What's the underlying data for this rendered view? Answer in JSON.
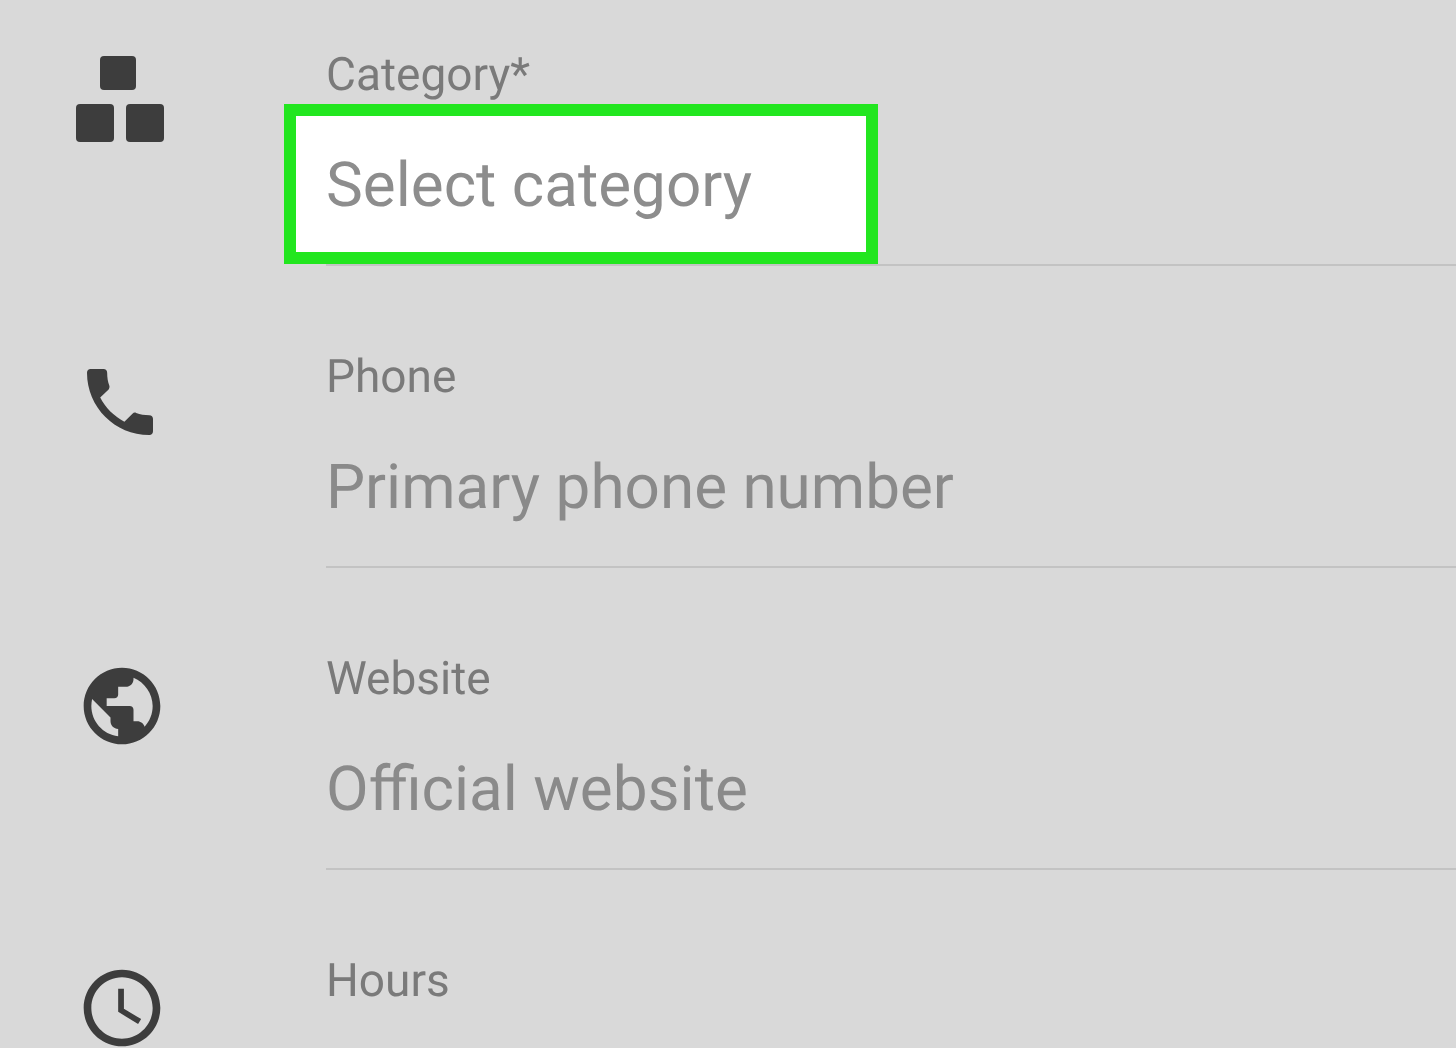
{
  "fields": [
    {
      "kind": "category",
      "label": "Category*",
      "placeholder": "Select category",
      "highlighted": true
    },
    {
      "kind": "phone",
      "label": "Phone",
      "placeholder": "Primary phone number",
      "highlighted": false
    },
    {
      "kind": "website",
      "label": "Website",
      "placeholder": "Official website",
      "highlighted": false
    },
    {
      "kind": "hours",
      "label": "Hours"
    }
  ]
}
